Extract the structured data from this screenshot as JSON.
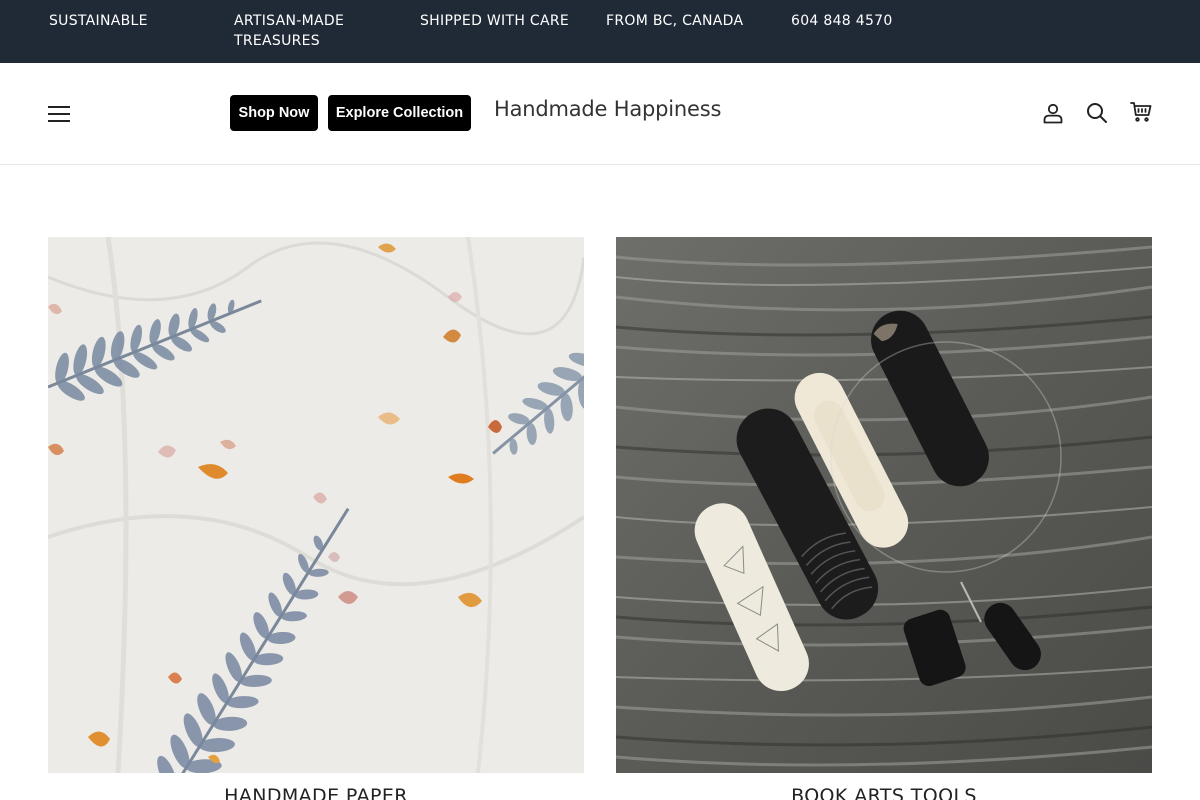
{
  "announcement": {
    "items": [
      "SUSTAINABLE",
      "ARTISAN-MADE TREASURES",
      "SHIPPED WITH CARE",
      "FROM BC, CANADA",
      "604 848 4570"
    ]
  },
  "header": {
    "menu_icon": "hamburger-menu-icon",
    "shop_now_label": "Shop Now",
    "explore_label": "Explore Collection",
    "logo_text": "Handmade Happiness",
    "icons": [
      "account-icon",
      "search-icon",
      "cart-icon"
    ]
  },
  "collections": [
    {
      "title": "HANDMADE PAPER",
      "image": "fern-petal-paper-image"
    },
    {
      "title": "BOOK ARTS TOOLS",
      "image": "bone-folder-tools-image"
    }
  ],
  "colors": {
    "topbar_bg": "#1f2a36",
    "button_bg": "#000000",
    "text": "#222222"
  }
}
